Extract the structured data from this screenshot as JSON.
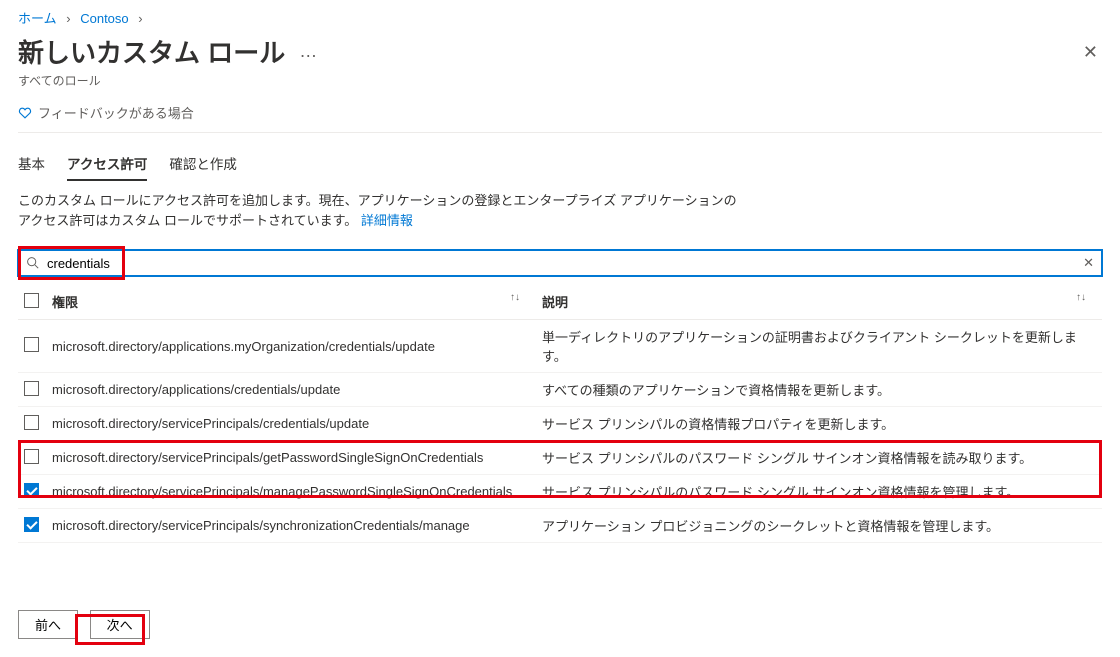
{
  "breadcrumb": {
    "home": "ホーム",
    "org": "Contoso"
  },
  "title": "新しいカスタム ロール",
  "subtitle": "すべてのロール",
  "feedback_label": "フィードバックがある場合",
  "tabs": {
    "basics": "基本",
    "permissions": "アクセス許可",
    "review": "確認と作成"
  },
  "description": "このカスタム ロールにアクセス許可を追加します。現在、アプリケーションの登録とエンタープライズ アプリケーションのアクセス許可はカスタム ロールでサポートされています。",
  "details_link": "詳細情報",
  "search": {
    "value": "credentials"
  },
  "columns": {
    "permission": "権限",
    "description": "説明"
  },
  "rows": [
    {
      "checked": false,
      "perm": "microsoft.directory/applications.myOrganization/credentials/update",
      "desc": "単一ディレクトリのアプリケーションの証明書およびクライアント シークレットを更新します。"
    },
    {
      "checked": false,
      "perm": "microsoft.directory/applications/credentials/update",
      "desc": "すべての種類のアプリケーションで資格情報を更新します。"
    },
    {
      "checked": false,
      "perm": "microsoft.directory/servicePrincipals/credentials/update",
      "desc": "サービス プリンシパルの資格情報プロパティを更新します。"
    },
    {
      "checked": false,
      "perm": "microsoft.directory/servicePrincipals/getPasswordSingleSignOnCredentials",
      "desc": "サービス プリンシパルのパスワード シングル サインオン資格情報を読み取ります。"
    },
    {
      "checked": true,
      "perm": "microsoft.directory/servicePrincipals/managePasswordSingleSignOnCredentials",
      "desc": "サービス プリンシパルのパスワード シングル サインオン資格情報を管理します。"
    },
    {
      "checked": true,
      "perm": "microsoft.directory/servicePrincipals/synchronizationCredentials/manage",
      "desc": "アプリケーション プロビジョニングのシークレットと資格情報を管理します。"
    }
  ],
  "buttons": {
    "prev": "前へ",
    "next": "次へ"
  }
}
